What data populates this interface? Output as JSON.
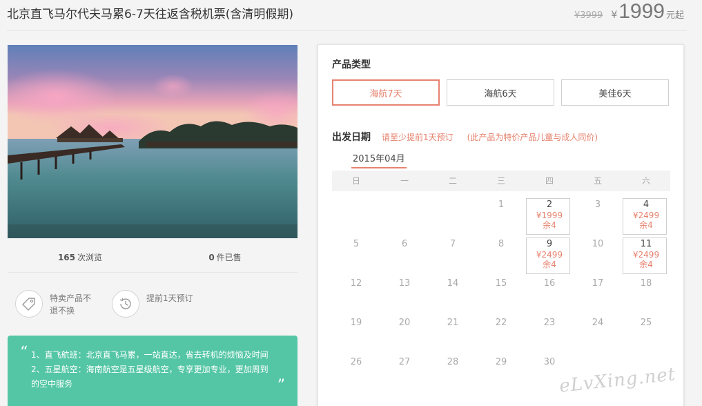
{
  "header": {
    "title": "北京直飞马尔代夫马累6-7天往返含税机票(含清明假期)",
    "old_price": "¥3999",
    "currency": "¥",
    "price": "1999",
    "price_suffix": "元起"
  },
  "stats": {
    "views": "165",
    "views_label": "次浏览",
    "sold": "0",
    "sold_label": "件已售"
  },
  "features": [
    {
      "icon": "tag-icon",
      "text": "特卖产品不退不换"
    },
    {
      "icon": "history-clock-icon",
      "text": "提前1天预订"
    }
  ],
  "highlights": {
    "open_quote": "“",
    "close_quote": "”",
    "lines": [
      "1、直飞航班：北京直飞马累，一站直达，省去转机的烦恼及时间",
      "2、五星航空：海南航空是五星级航空，专享更加专业，更加周到",
      "的空中服务"
    ]
  },
  "product_type": {
    "title": "产品类型",
    "options": [
      {
        "label": "海航7天",
        "selected": true
      },
      {
        "label": "海航6天",
        "selected": false
      },
      {
        "label": "美佳6天",
        "selected": false
      }
    ]
  },
  "departure": {
    "title": "出发日期",
    "note": "请至少提前1天预订",
    "note2": "(此产品为特价产品儿童与成人同价)",
    "month": "2015年04月",
    "weekdays": [
      "日",
      "一",
      "二",
      "三",
      "四",
      "五",
      "六"
    ],
    "weeks": [
      [
        null,
        null,
        null,
        {
          "d": "1"
        },
        {
          "d": "2",
          "price": "¥1999",
          "stock": "余4"
        },
        {
          "d": "3"
        },
        {
          "d": "4",
          "price": "¥2499",
          "stock": "余4"
        }
      ],
      [
        {
          "d": "5"
        },
        {
          "d": "6"
        },
        {
          "d": "7"
        },
        {
          "d": "8"
        },
        {
          "d": "9",
          "price": "¥2499",
          "stock": "余4"
        },
        {
          "d": "10"
        },
        {
          "d": "11",
          "price": "¥2499",
          "stock": "余4"
        }
      ],
      [
        {
          "d": "12"
        },
        {
          "d": "13"
        },
        {
          "d": "14"
        },
        {
          "d": "15"
        },
        {
          "d": "16"
        },
        {
          "d": "17"
        },
        {
          "d": "18"
        }
      ],
      [
        {
          "d": "19"
        },
        {
          "d": "20"
        },
        {
          "d": "21"
        },
        {
          "d": "22"
        },
        {
          "d": "23"
        },
        {
          "d": "24"
        },
        {
          "d": "25"
        }
      ],
      [
        {
          "d": "26"
        },
        {
          "d": "27"
        },
        {
          "d": "28"
        },
        {
          "d": "29"
        },
        {
          "d": "30"
        },
        null,
        null
      ]
    ]
  },
  "watermark": "eLvXing.net",
  "colors": {
    "accent": "#e6826e",
    "green": "#54c6a5"
  }
}
